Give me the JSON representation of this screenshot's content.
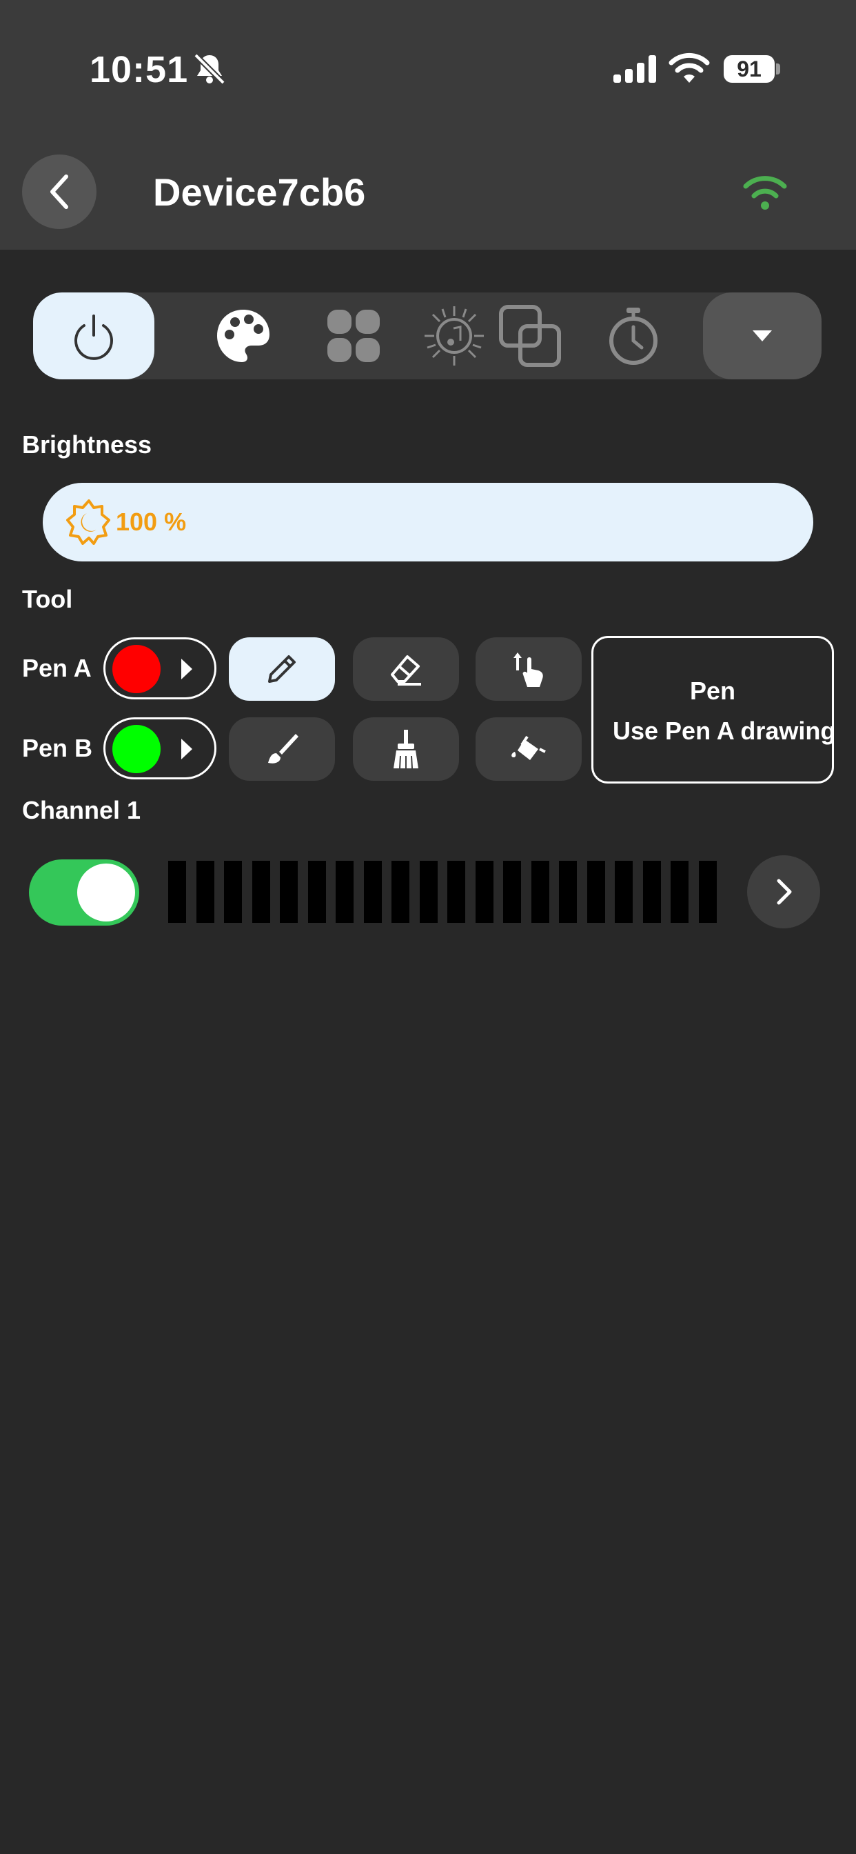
{
  "status_bar": {
    "time": "10:51",
    "battery": "91",
    "icons": [
      "bell-slash-icon",
      "cellular-signal-icon",
      "wifi-icon",
      "battery-icon"
    ]
  },
  "header": {
    "title": "Device7cb6",
    "back_icon": "chevron-left-icon",
    "connection_icon": "wifi-icon",
    "connection_color": "#4caf50"
  },
  "tabs": [
    {
      "name": "power",
      "icon": "power-icon",
      "active": true
    },
    {
      "name": "palette",
      "icon": "palette-icon"
    },
    {
      "name": "scenes",
      "icon": "grid-icon"
    },
    {
      "name": "music",
      "icon": "music-sun-icon"
    },
    {
      "name": "overlay",
      "icon": "overlay-squares-icon"
    },
    {
      "name": "timer",
      "icon": "stopwatch-icon"
    },
    {
      "name": "more",
      "icon": "caret-down-icon"
    }
  ],
  "brightness": {
    "label": "Brightness",
    "value_text": "100 %",
    "value": 100,
    "accent": "#f29d12"
  },
  "tool": {
    "label": "Tool",
    "pens": [
      {
        "label": "Pen A",
        "color": "#ff0000"
      },
      {
        "label": "Pen B",
        "color": "#00ff00"
      }
    ],
    "buttons": [
      {
        "name": "pencil",
        "icon": "pencil-icon",
        "active": true
      },
      {
        "name": "eraser",
        "icon": "eraser-icon"
      },
      {
        "name": "touch",
        "icon": "touch-move-icon"
      },
      {
        "name": "brush",
        "icon": "brush-icon"
      },
      {
        "name": "broom",
        "icon": "broom-icon"
      },
      {
        "name": "fill",
        "icon": "paint-bucket-icon"
      }
    ],
    "info": {
      "title": "Pen",
      "text": "Use Pen A drawing"
    }
  },
  "channel": {
    "label": "Channel 1",
    "enabled": true,
    "toggle_color": "#34c759",
    "next_icon": "chevron-right-icon"
  }
}
